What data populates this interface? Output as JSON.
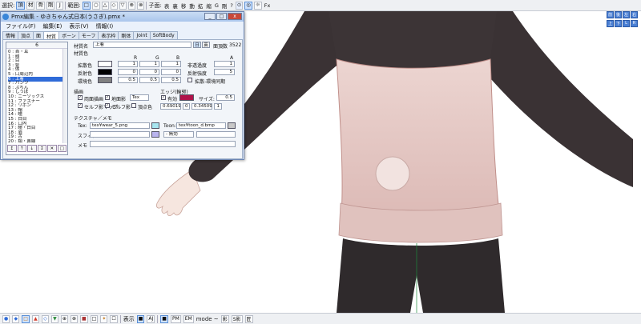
{
  "toolbar": {
    "select_label": "選択:",
    "select_buttons": [
      "頂",
      "材",
      "骨",
      "剛",
      "J"
    ],
    "range_label": "範囲:",
    "range_buttons": [
      "□",
      "○",
      "△",
      "◇",
      "▽"
    ],
    "icon_buttons": [
      "⊕",
      "⊗"
    ],
    "bone_label": "子面:",
    "bone_buttons": [
      "表",
      "裏",
      "移",
      "動",
      "拡",
      "縮",
      "G",
      "剛",
      "?"
    ],
    "fx_label": "Fx"
  },
  "viewcube": [
    "前",
    "後",
    "左",
    "右",
    "上",
    "下",
    "L",
    "R"
  ],
  "window": {
    "title": "Pmx編集 - ゆきちゃん式日本(うさぎ).pmx *",
    "controls": [
      "_",
      "□",
      "x"
    ],
    "menu": [
      "ファイル(F)",
      "編集(E)",
      "表示(V)",
      "情報(I)"
    ],
    "tabs": [
      "情報",
      "頂点",
      "面",
      "材質",
      "ボーン",
      "モーフ",
      "表示枠",
      "剛体",
      "Joint",
      "SoftBody"
    ],
    "active_tab": "材質"
  },
  "material_list": {
    "header": "6",
    "items": [
      "0 : 首・耳",
      "1 : 顔",
      "2 : 目",
      "3 : 髪",
      "4 : 体",
      "5 : 口周辺内",
      "6 : 上着",
      "7 : パンツ",
      "8 : ぷちん",
      "9 : しっぽ",
      "10 : ニーソックス",
      "11 : ファスナー",
      "12 : リボン",
      "13 : 帽",
      "14 : 瞳",
      "15 : 白目",
      "16 : 口内",
      "17 : 瞳・白目",
      "18 : 眉",
      "19 : 舌",
      "20 : 頬・鼻線"
    ],
    "selected_index": 6,
    "buttons": [
      "↥",
      "↑",
      "↓",
      "↧",
      "✕",
      "□"
    ]
  },
  "material": {
    "name_label": "材質名",
    "name_value": "上着",
    "jp_button": "日",
    "en_button": "英",
    "face_count_label": "面頂数",
    "face_count_value": "3522",
    "color_section": "材質色",
    "col_r": "R",
    "col_g": "G",
    "col_b": "B",
    "col_a": "A",
    "diffuse_label": "拡散色",
    "diffuse_values": [
      "1",
      "1",
      "1",
      "1"
    ],
    "diffuse_swatch": "#ffffff",
    "specular_label": "反射色",
    "specular_values": [
      "0",
      "0",
      "0"
    ],
    "specular_swatch": "#000000",
    "ambient_label": "環境色",
    "ambient_values": [
      "0.5",
      "0.5",
      "0.5"
    ],
    "ambient_swatch": "#808080",
    "nonpass_label": "非透過度",
    "nonpass_value": "1",
    "spec_strength_label": "反射強度",
    "spec_strength_value": "5",
    "sync_label": "拡散-環境同期",
    "draw_section": "描画",
    "both_sides": "両面描画",
    "ground_shadow": "地面影",
    "tex_mode": "Tex",
    "selfshadow_map": "セルフ影マップ",
    "selfshadow": "セルフ影",
    "vertex_color": "頂点色",
    "edge_section": "エッジ(輪郭)",
    "edge_enabled": "有効",
    "edge_swatch": "#b0134a",
    "edge_size_label": "サイズ:",
    "edge_size_value": "0.5",
    "edge_v1": "0.690196",
    "edge_v2": "0",
    "edge_v3": "0.345098",
    "edge_v4": "1",
    "tex_section": "テクスチャ／メモ",
    "tex_label": "Tex:",
    "tex_value": "tex¥wear_5.png",
    "tex_swatch": "#a8e6f0",
    "toon_label": "Toon:",
    "toon_value": "tex¥toon_d.bmp",
    "sphere_label": "スフィア",
    "sphere_swatch": "#b9b4ee",
    "sphere_mode": "- 無効",
    "memo_label": "メモ"
  },
  "bottom_toolbar": {
    "buttons_left": [
      "●",
      "◆",
      "□",
      "▲",
      "◇",
      "▼",
      "⊕",
      "⊗",
      "■",
      "□",
      "✦",
      "☐"
    ],
    "display_label": "表示",
    "display_buttons": [
      "■",
      "AJ"
    ],
    "mode_buttons": [
      "■",
      "PM",
      "EM"
    ],
    "mode_label": "mode ~",
    "right_buttons": [
      "影",
      "S影",
      "匠"
    ]
  }
}
